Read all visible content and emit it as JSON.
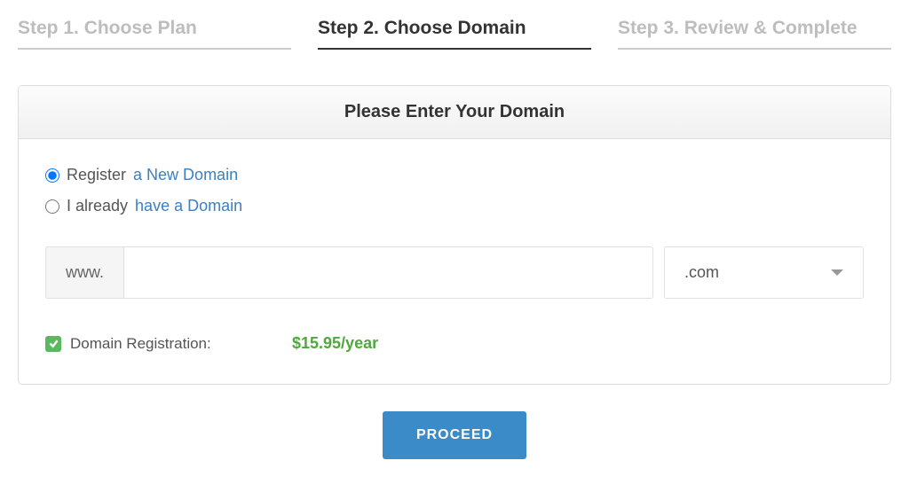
{
  "steps": {
    "step1": "Step 1. Choose Plan",
    "step2": "Step 2. Choose Domain",
    "step3": "Step 3. Review & Complete"
  },
  "panel": {
    "header": "Please Enter Your Domain"
  },
  "options": {
    "register_text": "Register",
    "register_link": "a New Domain",
    "already_text": "I already",
    "already_link": "have a Domain"
  },
  "input": {
    "prefix": "www.",
    "tld": ".com"
  },
  "registration": {
    "label": "Domain Registration:",
    "price": "$15.95/year"
  },
  "buttons": {
    "proceed": "PROCEED"
  }
}
